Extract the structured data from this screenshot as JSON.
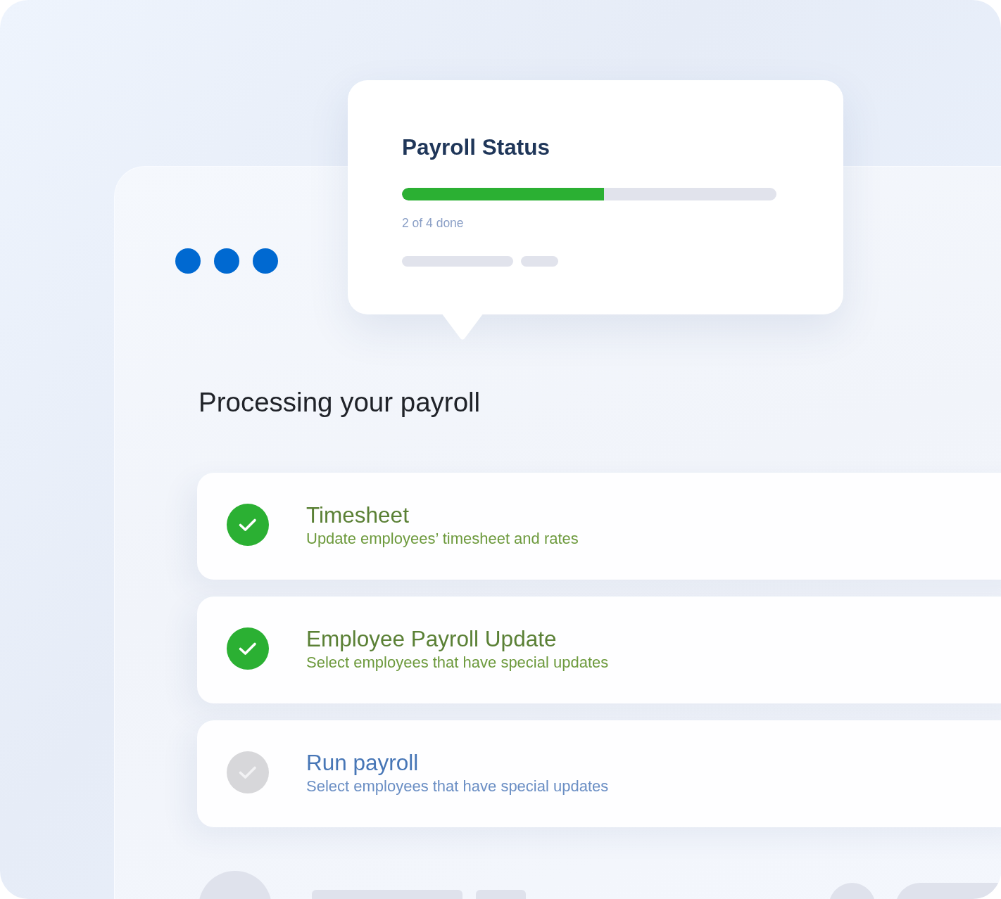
{
  "status_card": {
    "title": "Payroll Status",
    "progress": {
      "level": 0.54
    },
    "caption": "2 of 4 done"
  },
  "heading": "Processing your payroll",
  "steps": [
    {
      "title": "Timesheet",
      "description": "Update employees’ timesheet and rates",
      "done": true
    },
    {
      "title": "Employee Payroll Update",
      "description": "Select employees that have special updates",
      "done": true
    },
    {
      "title": "Run payroll",
      "description": "Select employees that have special updates",
      "done": false
    }
  ]
}
